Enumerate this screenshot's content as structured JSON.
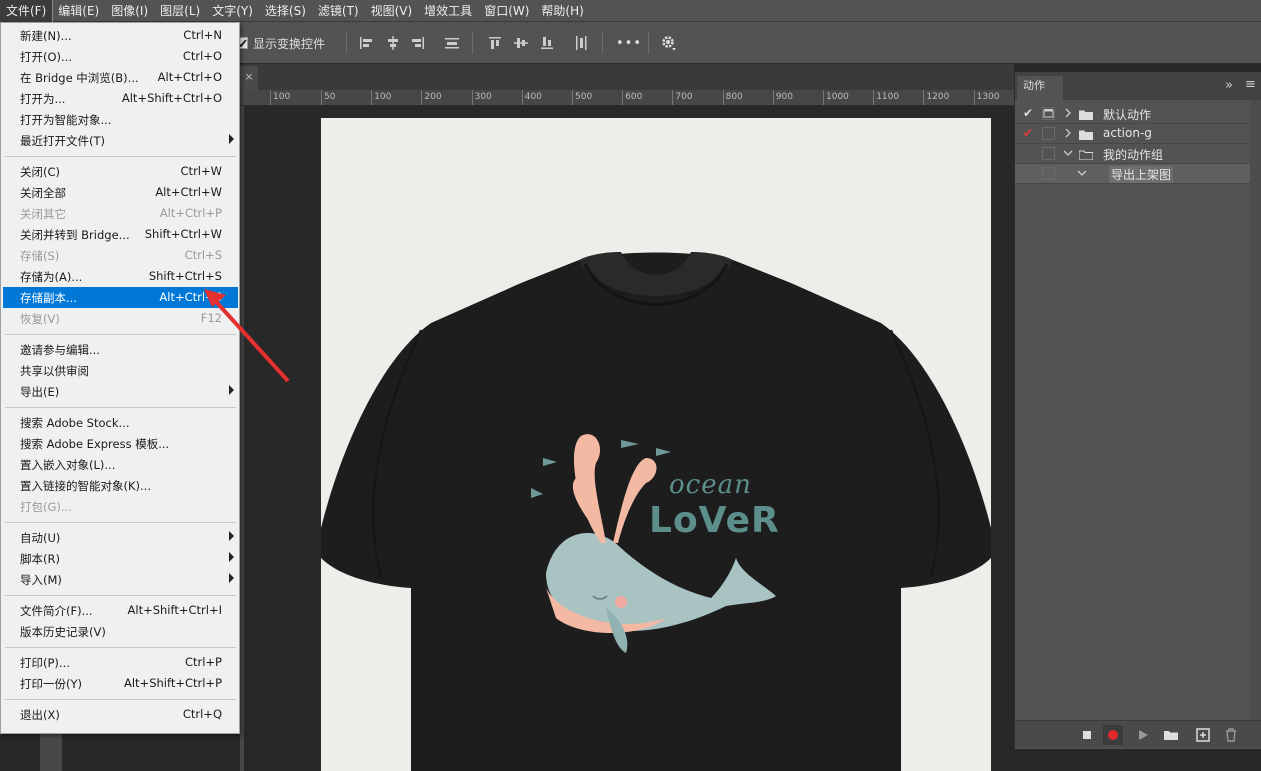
{
  "menubar": {
    "items": [
      "文件(F)",
      "编辑(E)",
      "图像(I)",
      "图层(L)",
      "文字(Y)",
      "选择(S)",
      "滤镜(T)",
      "视图(V)",
      "增效工具",
      "窗口(W)",
      "帮助(H)"
    ]
  },
  "options": {
    "show_transform_label": "显示变换控件",
    "more_label": "•••"
  },
  "doc_tab": {
    "close": "×"
  },
  "ruler": {
    "ticks": [
      "100",
      "50",
      "100",
      "200",
      "300",
      "400",
      "500",
      "600",
      "700",
      "800",
      "900",
      "1000",
      "1100",
      "1200",
      "1300"
    ]
  },
  "file_menu": {
    "items": [
      {
        "label": "新建(N)...",
        "shortcut": "Ctrl+N",
        "state": "normal"
      },
      {
        "label": "打开(O)...",
        "shortcut": "Ctrl+O",
        "state": "normal"
      },
      {
        "label": "在 Bridge 中浏览(B)...",
        "shortcut": "Alt+Ctrl+O",
        "state": "normal"
      },
      {
        "label": "打开为...",
        "shortcut": "Alt+Shift+Ctrl+O",
        "state": "normal"
      },
      {
        "label": "打开为智能对象...",
        "shortcut": "",
        "state": "normal"
      },
      {
        "label": "最近打开文件(T)",
        "shortcut": "",
        "state": "submenu"
      },
      {
        "label": "关闭(C)",
        "shortcut": "Ctrl+W",
        "state": "normal"
      },
      {
        "label": "关闭全部",
        "shortcut": "Alt+Ctrl+W",
        "state": "normal"
      },
      {
        "label": "关闭其它",
        "shortcut": "Alt+Ctrl+P",
        "state": "disabled"
      },
      {
        "label": "关闭并转到 Bridge...",
        "shortcut": "Shift+Ctrl+W",
        "state": "normal"
      },
      {
        "label": "存储(S)",
        "shortcut": "Ctrl+S",
        "state": "disabled"
      },
      {
        "label": "存储为(A)...",
        "shortcut": "Shift+Ctrl+S",
        "state": "normal"
      },
      {
        "label": "存储副本...",
        "shortcut": "Alt+Ctrl+S",
        "state": "highlighted"
      },
      {
        "label": "恢复(V)",
        "shortcut": "F12",
        "state": "disabled"
      },
      {
        "label": "邀请参与编辑...",
        "shortcut": "",
        "state": "normal"
      },
      {
        "label": "共享以供审阅",
        "shortcut": "",
        "state": "normal"
      },
      {
        "label": "导出(E)",
        "shortcut": "",
        "state": "submenu"
      },
      {
        "label": "搜索 Adobe Stock...",
        "shortcut": "",
        "state": "normal"
      },
      {
        "label": "搜索 Adobe Express 模板...",
        "shortcut": "",
        "state": "normal"
      },
      {
        "label": "置入嵌入对象(L)...",
        "shortcut": "",
        "state": "normal"
      },
      {
        "label": "置入链接的智能对象(K)...",
        "shortcut": "",
        "state": "normal"
      },
      {
        "label": "打包(G)...",
        "shortcut": "",
        "state": "disabled"
      },
      {
        "label": "自动(U)",
        "shortcut": "",
        "state": "submenu"
      },
      {
        "label": "脚本(R)",
        "shortcut": "",
        "state": "submenu"
      },
      {
        "label": "导入(M)",
        "shortcut": "",
        "state": "submenu"
      },
      {
        "label": "文件简介(F)...",
        "shortcut": "Alt+Shift+Ctrl+I",
        "state": "normal"
      },
      {
        "label": "版本历史记录(V)",
        "shortcut": "",
        "state": "normal"
      },
      {
        "label": "打印(P)...",
        "shortcut": "Ctrl+P",
        "state": "normal"
      },
      {
        "label": "打印一份(Y)",
        "shortcut": "Alt+Shift+Ctrl+P",
        "state": "normal"
      },
      {
        "label": "退出(X)",
        "shortcut": "Ctrl+Q",
        "state": "normal"
      }
    ]
  },
  "actions_panel": {
    "title": "动作",
    "collapse": "»",
    "menu": "≡",
    "rows": [
      {
        "label": "默认动作",
        "checked": true,
        "check_color": "#dddddd",
        "expanded": false,
        "has_dialog_icon": true
      },
      {
        "label": "action-g",
        "checked": true,
        "check_color": "#e03c3c",
        "expanded": false,
        "has_dialog_icon": false
      },
      {
        "label": "我的动作组",
        "checked": false,
        "check_color": "",
        "expanded": true,
        "has_dialog_icon": false
      },
      {
        "label": "导出上架图",
        "checked": false,
        "check_color": "",
        "expanded": true,
        "has_dialog_icon": false
      }
    ]
  },
  "artwork": {
    "word1": "ocean",
    "word2": "LoVeR",
    "text_color": "#5c8f8c"
  },
  "colors": {
    "highlight": "#0078d7",
    "record_red": "#e02a2a",
    "arrow_red": "#e53030"
  }
}
